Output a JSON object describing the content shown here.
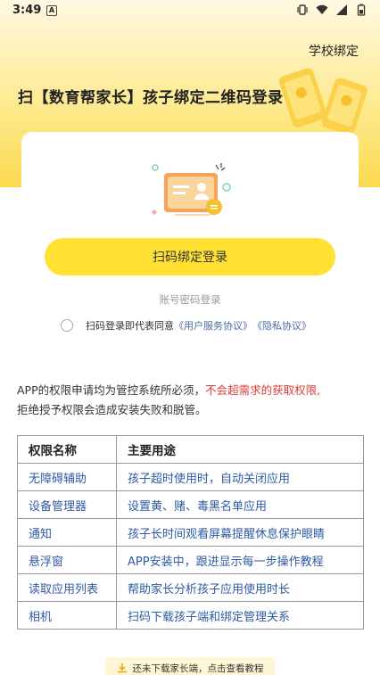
{
  "status_bar": {
    "time": "3:49",
    "notif_letter": "A"
  },
  "header": {
    "school_bind": "学校绑定",
    "title": "扫【数育帮家长】孩子绑定二维码登录"
  },
  "login": {
    "scan_button": "扫码绑定登录",
    "account_login": "账号密码登录",
    "agreement_prefix": "扫码登录即代表同意",
    "user_agreement": "《用户服务协议》",
    "privacy_agreement": "《隐私协议》"
  },
  "notice": {
    "text_prefix": "APP的权限申请均为管控系统所必须，",
    "text_highlight": "不会超需求的获取权限,",
    "text_suffix": "拒绝授予权限会造成安装失败和脱管。"
  },
  "permissions": {
    "headers": [
      "权限名称",
      "主要用途"
    ],
    "rows": [
      [
        "无障碍辅助",
        "孩子超时使用时，自动关闭应用"
      ],
      [
        "设备管理器",
        "设置黄、赌、毒黑名单应用"
      ],
      [
        "通知",
        "孩子长时间观看屏幕提醒休息保护眼睛"
      ],
      [
        "悬浮窗",
        "APP安装中，跟进显示每一步操作教程"
      ],
      [
        "读取应用列表",
        "帮助家长分析孩子应用使用时长"
      ],
      [
        "相机",
        "扫码下载孩子端和绑定管理关系"
      ]
    ]
  },
  "download": {
    "label": "还未下载家长端，点击查看教程"
  },
  "colors": {
    "accent": "#ffe033",
    "link": "#4a6fa5",
    "warning": "#e03a3a",
    "table_text": "#2f5aa6"
  }
}
